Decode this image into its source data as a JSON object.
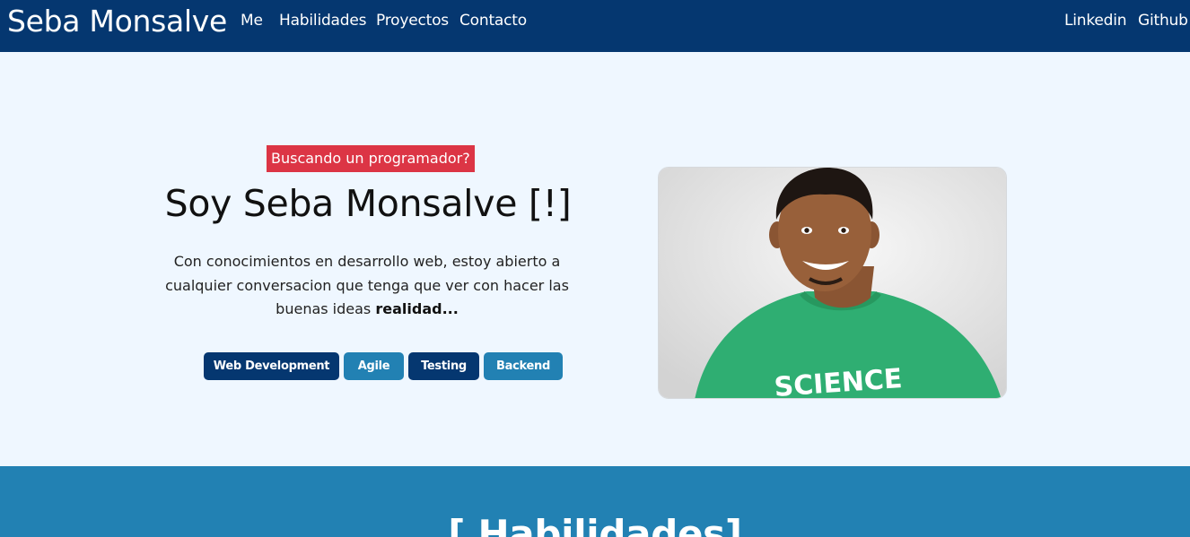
{
  "navbar": {
    "brand": "Seba Monsalve",
    "links": [
      "Me",
      "Habilidades",
      "Proyectos",
      "Contacto"
    ],
    "social": [
      "Linkedin",
      "Github"
    ]
  },
  "hero": {
    "tagline": "Buscando un programador?",
    "headline": "Soy Seba Monsalve [!]",
    "intro": "Con conocimientos en desarrollo web, estoy abierto a cualquier conversacion que tenga que ver con hacer las buenas ideas",
    "intro_bold": "realidad...",
    "tags": [
      "Web Development",
      "Agile",
      "Testing",
      "Backend"
    ]
  },
  "skills": {
    "title": "[ Habilidades]"
  },
  "colors": {
    "navbar": "#053770",
    "page_background": "#eff7ff",
    "tagline_background": "#dc3545",
    "tag_dark": "#053770",
    "tag_light": "#2281b3",
    "skills_background": "#2281b3"
  }
}
